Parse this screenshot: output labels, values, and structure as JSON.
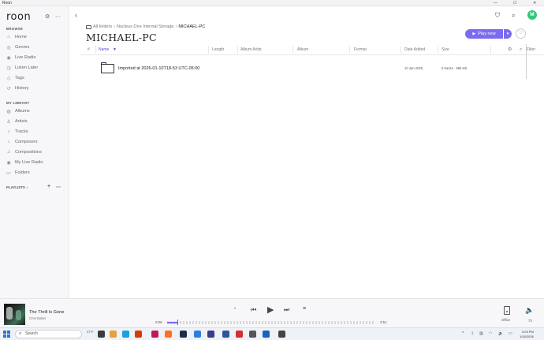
{
  "window": {
    "title": "Roon",
    "controls": {
      "minimize": "—",
      "maximize": "☐",
      "close": "✕"
    }
  },
  "sidebar": {
    "logo": "roon",
    "browse_label": "BROWSE",
    "browse_items": [
      {
        "label": "Home",
        "icon": "home-icon"
      },
      {
        "label": "Genres",
        "icon": "genres-icon"
      },
      {
        "label": "Live Radio",
        "icon": "radio-icon"
      },
      {
        "label": "Listen Later",
        "icon": "clock-icon"
      },
      {
        "label": "Tags",
        "icon": "tag-icon"
      },
      {
        "label": "History",
        "icon": "history-icon"
      }
    ],
    "library_label": "MY LIBRARY",
    "library_items": [
      {
        "label": "Albums",
        "icon": "album-icon"
      },
      {
        "label": "Artists",
        "icon": "artist-icon"
      },
      {
        "label": "Tracks",
        "icon": "track-icon"
      },
      {
        "label": "Composers",
        "icon": "composer-icon"
      },
      {
        "label": "Compositions",
        "icon": "composition-icon"
      },
      {
        "label": "My Live Radio",
        "icon": "radio-icon"
      },
      {
        "label": "Folders",
        "icon": "folder-icon"
      }
    ],
    "playlists_label": "PLAYLISTS",
    "playlists_chevron": "›"
  },
  "header": {
    "avatar_initial": "M"
  },
  "breadcrumb": {
    "root": "All folders",
    "middle": "Nucleus One Internal Storage",
    "current": "MICHAEL-PC",
    "separator": "›"
  },
  "page_title": "MICHAEL-PC",
  "actions": {
    "play_now": "Play now",
    "play_dropdown": "▼",
    "heart": "♡"
  },
  "table": {
    "columns": {
      "number": "#",
      "name": "Name",
      "sort_indicator": "▼",
      "length": "Length",
      "album_artist": "Album Artist",
      "album": "Album",
      "format": "Format",
      "date_added": "Date Added",
      "size": "Size",
      "filter": "Filter"
    },
    "rows": [
      {
        "name": "Imported at 2026-01-10T18-53 UTC-05:00",
        "date_added": "10 Jan 2026",
        "size": "0 tracks · 990 KB"
      }
    ]
  },
  "now_playing": {
    "title": "The Thrill Is Gone",
    "artist": "Chet Baker",
    "elapsed": "0:08",
    "duration": "2:51",
    "progress_fraction": 0.05,
    "zone": "Office",
    "volume": "73"
  },
  "taskbar": {
    "search_placeholder": "Search",
    "weather": "37°F",
    "time": "3:03 PM",
    "date": "1/16/2026"
  }
}
